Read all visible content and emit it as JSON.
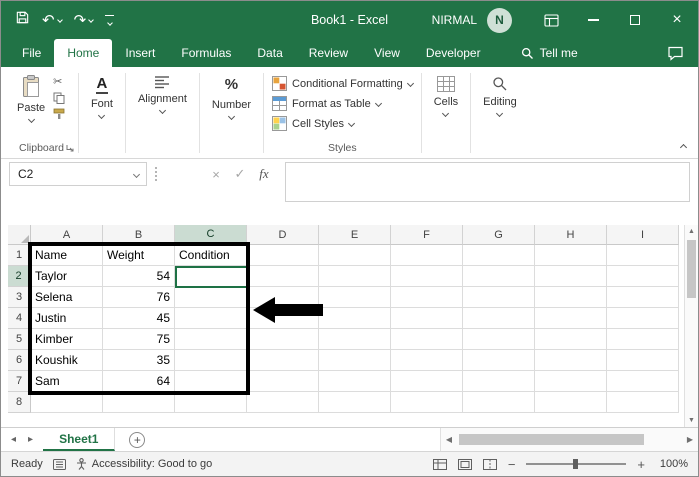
{
  "colors": {
    "brand_green": "#217346",
    "selection_border": "#1E7145",
    "annotation_black": "#000000",
    "selected_header_bg": "#CBDCD2"
  },
  "titlebar": {
    "title": "Book1 - Excel",
    "user_name": "NIRMAL",
    "avatar_initial": "N"
  },
  "tabs": {
    "items": [
      "File",
      "Home",
      "Insert",
      "Formulas",
      "Data",
      "Review",
      "View",
      "Developer"
    ],
    "active": "Home",
    "tell_me_label": "Tell me"
  },
  "ribbon": {
    "clipboard": {
      "paste_label": "Paste",
      "group_label": "Clipboard"
    },
    "font_label": "Font",
    "alignment_label": "Alignment",
    "number_label": "Number",
    "styles": {
      "conditional_formatting": "Conditional Formatting",
      "format_as_table": "Format as Table",
      "cell_styles": "Cell Styles",
      "group_label": "Styles"
    },
    "cells_label": "Cells",
    "editing_label": "Editing"
  },
  "formula_bar": {
    "name_box_value": "C2",
    "fx_label": "fx"
  },
  "grid": {
    "column_headers": [
      "A",
      "B",
      "C",
      "D",
      "E",
      "F",
      "G",
      "H",
      "I"
    ],
    "row_count": 8,
    "selected_cell": "C2",
    "selected_column": "C",
    "selected_row": 2,
    "data": {
      "headers": [
        "Name",
        "Weight",
        "Condition"
      ],
      "rows": [
        [
          "Taylor",
          54
        ],
        [
          "Selena",
          76
        ],
        [
          "Justin",
          45
        ],
        [
          "Kimber",
          75
        ],
        [
          "Koushik",
          35
        ],
        [
          "Sam",
          64
        ]
      ]
    },
    "annotations": {
      "highlighted_range": "A1:C7"
    }
  },
  "sheet_bar": {
    "active_sheet": "Sheet1"
  },
  "status_bar": {
    "ready_label": "Ready",
    "accessibility_label": "Accessibility: Good to go",
    "zoom_level": "100%"
  }
}
